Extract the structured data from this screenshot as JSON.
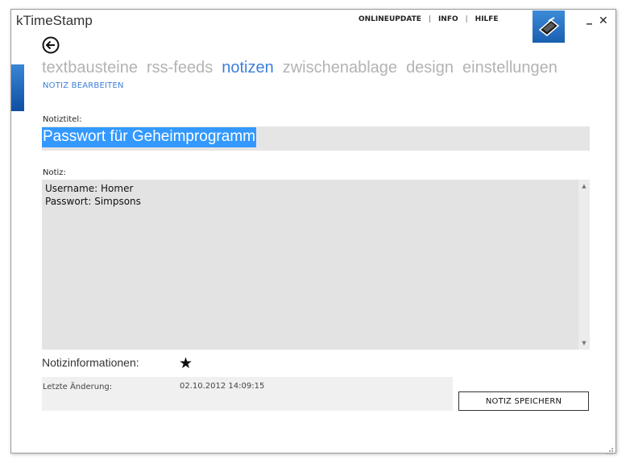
{
  "window": {
    "app_title": "kTimeStamp"
  },
  "top_menu": {
    "items": [
      "ONLINEUPDATE",
      "INFO",
      "HILFE"
    ],
    "separator": "|"
  },
  "window_controls": {
    "minimize": "_",
    "close": "✕"
  },
  "nav": {
    "tabs": [
      "textbausteine",
      "rss-feeds",
      "notizen",
      "zwischenablage",
      "design",
      "einstellungen"
    ],
    "active_tab": "notizen"
  },
  "subnav": {
    "label": "NOTIZ BEARBEITEN"
  },
  "form": {
    "title_label": "Notiztitel:",
    "title_value": "Passwort für Geheimprogramm",
    "note_label": "Notiz:",
    "note_value": "Username: Homer\nPasswort: Simpsons"
  },
  "info": {
    "heading": "Notizinformationen:",
    "favorite_icon": "star-icon",
    "last_change_label": "Letzte Änderung:",
    "last_change_value": "02.10.2012 14:09:15"
  },
  "actions": {
    "save_label": "NOTIZ SPEICHERN"
  },
  "colors": {
    "accent_blue": "#3d7fd9",
    "selection": "#3399ff",
    "field_bg": "#e5e5e5",
    "inactive_tab": "#b3b3b3"
  }
}
